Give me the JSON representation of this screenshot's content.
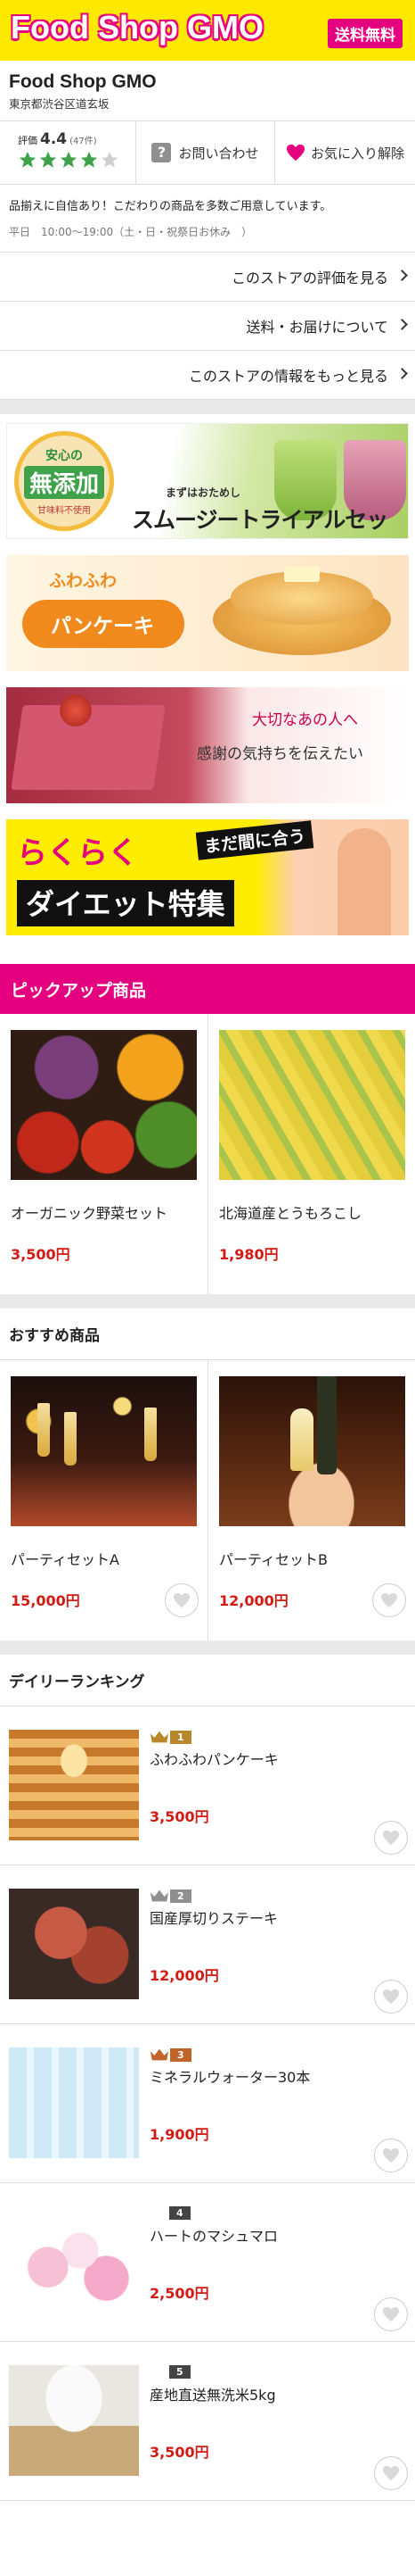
{
  "header": {
    "title": "Food Shop GMO",
    "badge": "送料無料"
  },
  "shop": {
    "name": "Food Shop GMO",
    "address": "東京都渋谷区道玄坂",
    "rating_label": "評価",
    "rating_score": "4.4",
    "rating_count": "(47件)",
    "rating_stars": 4,
    "inquiry_label": "お問い合わせ",
    "favorite_label": "お気に入り解除",
    "description": "品揃えに自信あり！こだわりの商品を多数ご用意しています。",
    "hours": "平日　10:00～19:00（土・日・祝祭日お休み　）"
  },
  "links": [
    "このストアの評価を見る",
    "送料・お届けについて",
    "このストアの情報をもっと見る"
  ],
  "banners": {
    "smoothie": {
      "badge_top": "安心の",
      "badge_main": "無添加",
      "badge_sub": "甘味料不使用",
      "sub": "まずはおためし",
      "main": "スムージートライアルセット"
    },
    "pancake": {
      "top": "ふわふわ",
      "main": "パンケーキ"
    },
    "valentine": {
      "line1": "大切なあの人へ",
      "line2": "感謝の気持ちを伝えたい"
    },
    "diet": {
      "line1": "らくらく",
      "tag": "まだ間に合う",
      "line2": "ダイエット特集"
    }
  },
  "pickup": {
    "title": "ピックアップ商品",
    "items": [
      {
        "name": "オーガニック野菜セット",
        "price": "3,500円"
      },
      {
        "name": "北海道産とうもろこし",
        "price": "1,980円"
      }
    ]
  },
  "recommended": {
    "title": "おすすめ商品",
    "items": [
      {
        "name": "パーティセットA",
        "price": "15,000円"
      },
      {
        "name": "パーティセットB",
        "price": "12,000円"
      }
    ]
  },
  "ranking": {
    "title": "デイリーランキング",
    "items": [
      {
        "rank": "1",
        "name": "ふわふわパンケーキ",
        "price": "3,500円"
      },
      {
        "rank": "2",
        "name": "国産厚切りステーキ",
        "price": "12,000円"
      },
      {
        "rank": "3",
        "name": "ミネラルウォーター30本",
        "price": "1,900円"
      },
      {
        "rank": "4",
        "name": "ハートのマシュマロ",
        "price": "2,500円"
      },
      {
        "rank": "5",
        "name": "産地直送無洗米5kg",
        "price": "3,500円"
      }
    ]
  },
  "colors": {
    "brand_yellow": "#ffe900",
    "accent_pink": "#e5007f",
    "price_red": "#d21b13",
    "gold": "#b8862b",
    "silver": "#8f8f8f",
    "bronze": "#c0642a",
    "dark": "#444444"
  }
}
